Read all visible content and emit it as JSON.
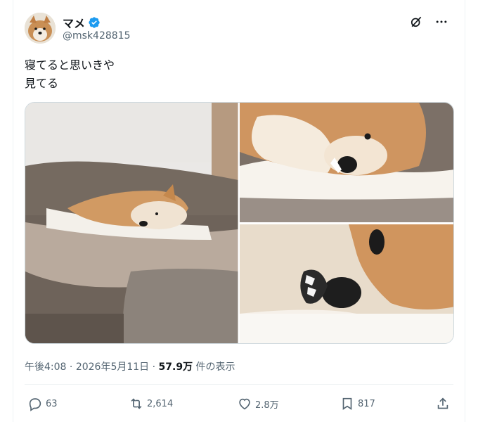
{
  "user": {
    "display_name": "マメ",
    "handle": "@msk428815",
    "verified": true,
    "avatar_icon": "shiba-avatar"
  },
  "header_actions": {
    "grok_icon": "grok-icon",
    "more_icon": "more-icon"
  },
  "tweet": {
    "text": "寝てると思いきや\n見てる"
  },
  "media": {
    "images": [
      "shiba-on-sofa-photo",
      "shiba-closeup-face-photo",
      "shiba-closeup-nose-photo"
    ]
  },
  "meta": {
    "time": "午後4:08",
    "separator": "·",
    "date": "2026年5月11日",
    "separator2": "·",
    "views_count": "57.9万",
    "views_label": "件の表示"
  },
  "actions": {
    "reply_count": "63",
    "retweet_count": "2,614",
    "like_count": "2.8万",
    "bookmark_count": "817"
  },
  "colors": {
    "accent": "#1d9bf0",
    "text": "#0f1419",
    "muted": "#536471"
  }
}
